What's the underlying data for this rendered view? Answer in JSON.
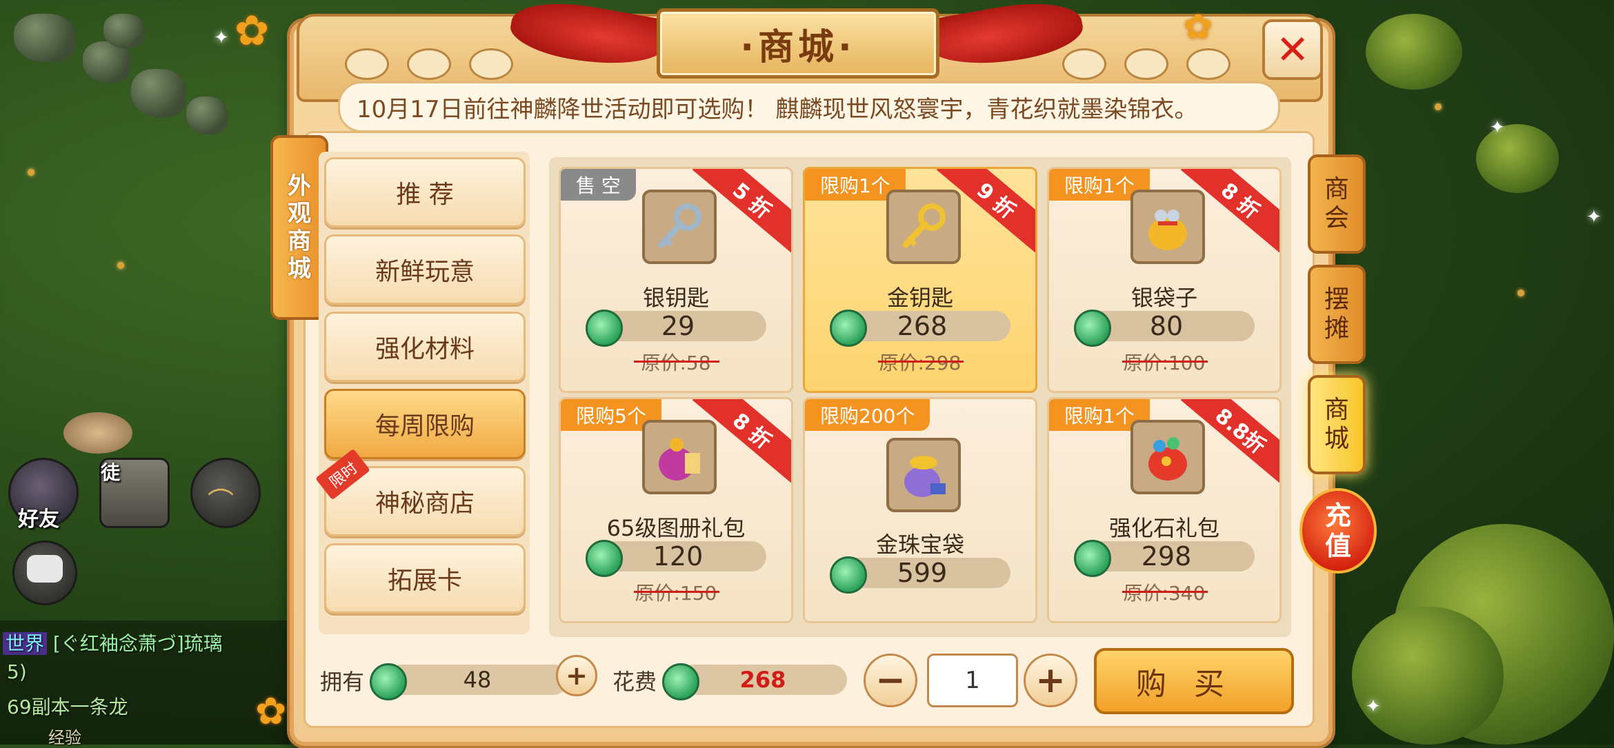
{
  "title": "·商城·",
  "marquee": "10月17日前往神麟降世活动即可选购！     麒麟现世风怒寰宇，青花织就墨染锦衣。",
  "side_sign": [
    "外",
    "观",
    "商",
    "城"
  ],
  "categories": [
    {
      "label": "推 荐"
    },
    {
      "label": "新鲜玩意"
    },
    {
      "label": "强化材料"
    },
    {
      "label": "每周限购"
    },
    {
      "label": "神秘商店"
    },
    {
      "label": "拓展卡"
    }
  ],
  "category_limit_tag": "限时",
  "items": [
    {
      "tag": "售 空",
      "discount": "5 折",
      "name": "银钥匙",
      "price": "29",
      "original": "原价:58"
    },
    {
      "tag": "限购1个",
      "discount": "9 折",
      "name": "金钥匙",
      "price": "268",
      "original": "原价:298"
    },
    {
      "tag": "限购1个",
      "discount": "8 折",
      "name": "银袋子",
      "price": "80",
      "original": "原价:100"
    },
    {
      "tag": "限购5个",
      "discount": "8 折",
      "name": "65级图册礼包",
      "price": "120",
      "original": "原价:150"
    },
    {
      "tag": "限购200个",
      "discount": "",
      "name": "金珠宝袋",
      "price": "599",
      "original": ""
    },
    {
      "tag": "限购1个",
      "discount": "8.8折",
      "name": "强化石礼包",
      "price": "298",
      "original": "原价:340"
    }
  ],
  "right_tabs": [
    {
      "label": [
        "商",
        "会"
      ]
    },
    {
      "label": [
        "摆",
        "摊"
      ]
    },
    {
      "label": [
        "商",
        "城"
      ]
    }
  ],
  "recharge": [
    "充",
    "值"
  ],
  "bottom": {
    "own_label": "拥有",
    "own_value": "48",
    "cost_label": "花费",
    "cost_value": "268",
    "quantity": "1",
    "buy_label": "购买",
    "minus": "−",
    "plus": "+"
  },
  "hud": {
    "friends_label": "好友",
    "apprentice_label": "徒"
  },
  "chat": {
    "channel": "世界",
    "line1": "[ぐ红袖念萧づ]琉璃",
    "line2": "5)",
    "line3": "69副本一条龙",
    "line4": "经验"
  },
  "colors": {
    "accent_orange": "#f59320",
    "discount_red": "#e2302a",
    "cost_red": "#d21c16"
  }
}
